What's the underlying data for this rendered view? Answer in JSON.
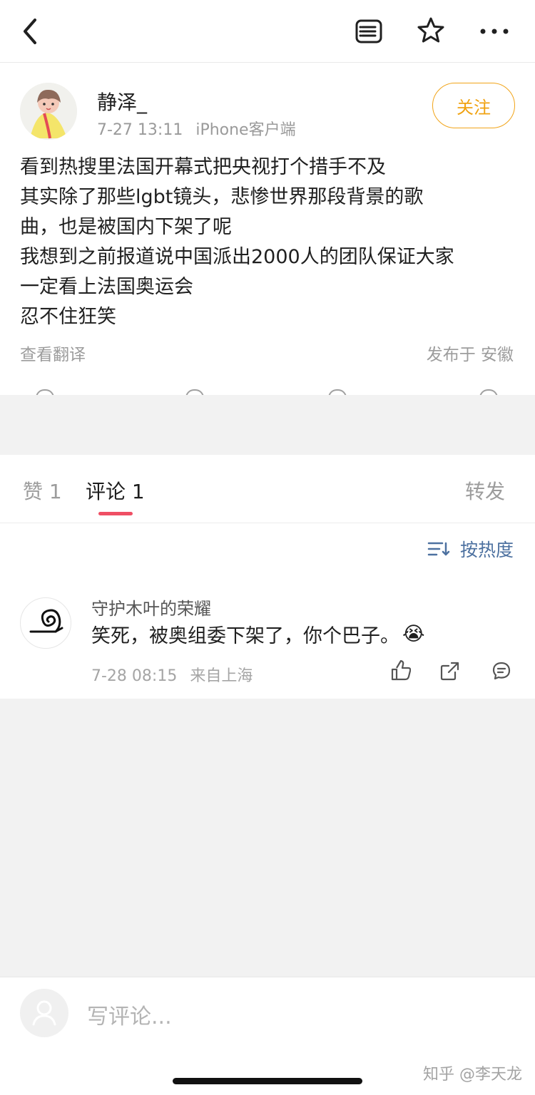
{
  "header": {
    "back_icon": "chevron-left-icon",
    "detail_icon": "document-list-icon",
    "favorite_icon": "star-outline-icon",
    "more_icon": "more-horizontal-icon"
  },
  "post": {
    "username": "静泽_",
    "date": "7-27 13:11",
    "source": "iPhone客户端",
    "follow_label": "关注",
    "lines": [
      "看到热搜里法国开幕式把央视打个措手不及",
      "其实除了那些lgbt镜头，悲惨世界那段背景的歌",
      "曲，也是被国内下架了呢",
      "我想到之前报道说中国派出2000人的团队保证大家",
      "一定看上法国奥运会",
      "忍不住狂笑"
    ],
    "translate_label": "查看翻译",
    "location_label": "发布于 安徽"
  },
  "tabs": {
    "likes": "赞 1",
    "comments": "评论 1",
    "reposts": "转发"
  },
  "comments": {
    "sort_label": "按热度",
    "items": [
      {
        "user": "守护木叶的荣耀",
        "text": "笑死，被奥组委下架了，你个巴子。",
        "emoji": "😭",
        "date": "7-28 08:15",
        "location": "来自上海"
      }
    ]
  },
  "bottom": {
    "placeholder": "写评论...",
    "watermark": "知乎 @李天龙"
  },
  "colors": {
    "accent_orange": "#f0a211",
    "active_tab_indicator": "#ef4f64",
    "sort_blue": "#4d71a0"
  }
}
